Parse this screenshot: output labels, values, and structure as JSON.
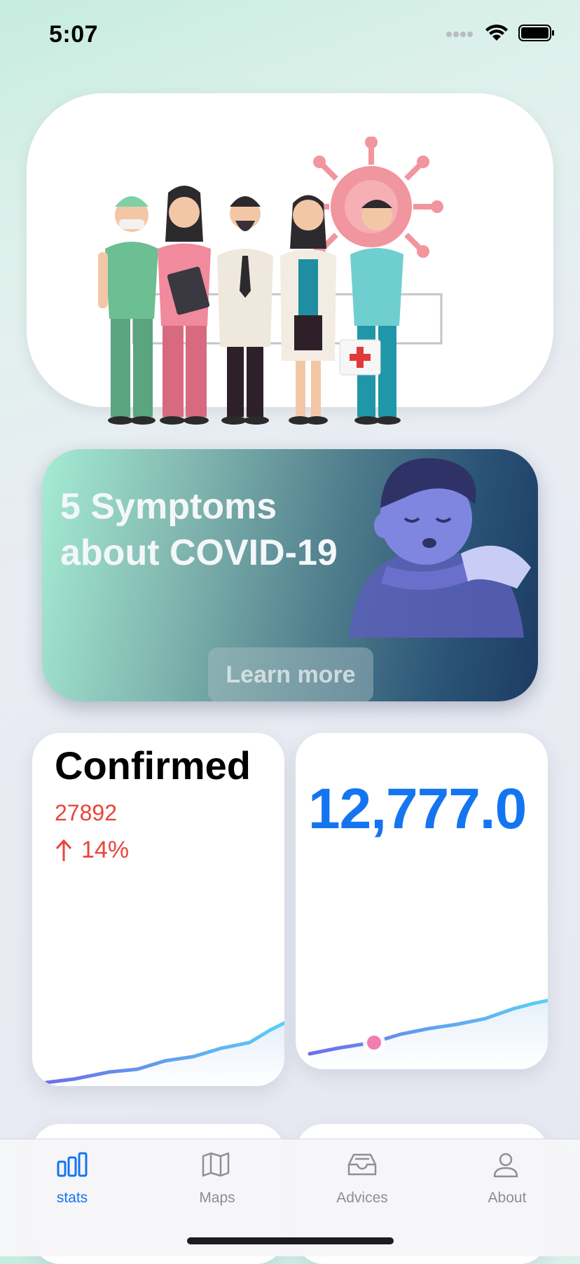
{
  "status_bar": {
    "time": "5:07"
  },
  "symptoms_card": {
    "title_line1": "5 Symptoms",
    "title_line2": "about COVID-19",
    "button_label": "Learn more"
  },
  "stats": {
    "confirmed_card": {
      "title": "Confirmed",
      "value": "27892",
      "change": "14%",
      "trend": "up",
      "color": "#e8453c"
    },
    "second_card": {
      "value": "12,777.0",
      "color": "#1475f0"
    }
  },
  "tab_bar": {
    "items": [
      {
        "label": "stats",
        "icon": "bar-chart-icon",
        "active": true
      },
      {
        "label": "Maps",
        "icon": "map-icon",
        "active": false
      },
      {
        "label": "Advices",
        "icon": "tray-icon",
        "active": false
      },
      {
        "label": "About",
        "icon": "person-icon",
        "active": false
      }
    ],
    "active_color": "#1475f0"
  }
}
